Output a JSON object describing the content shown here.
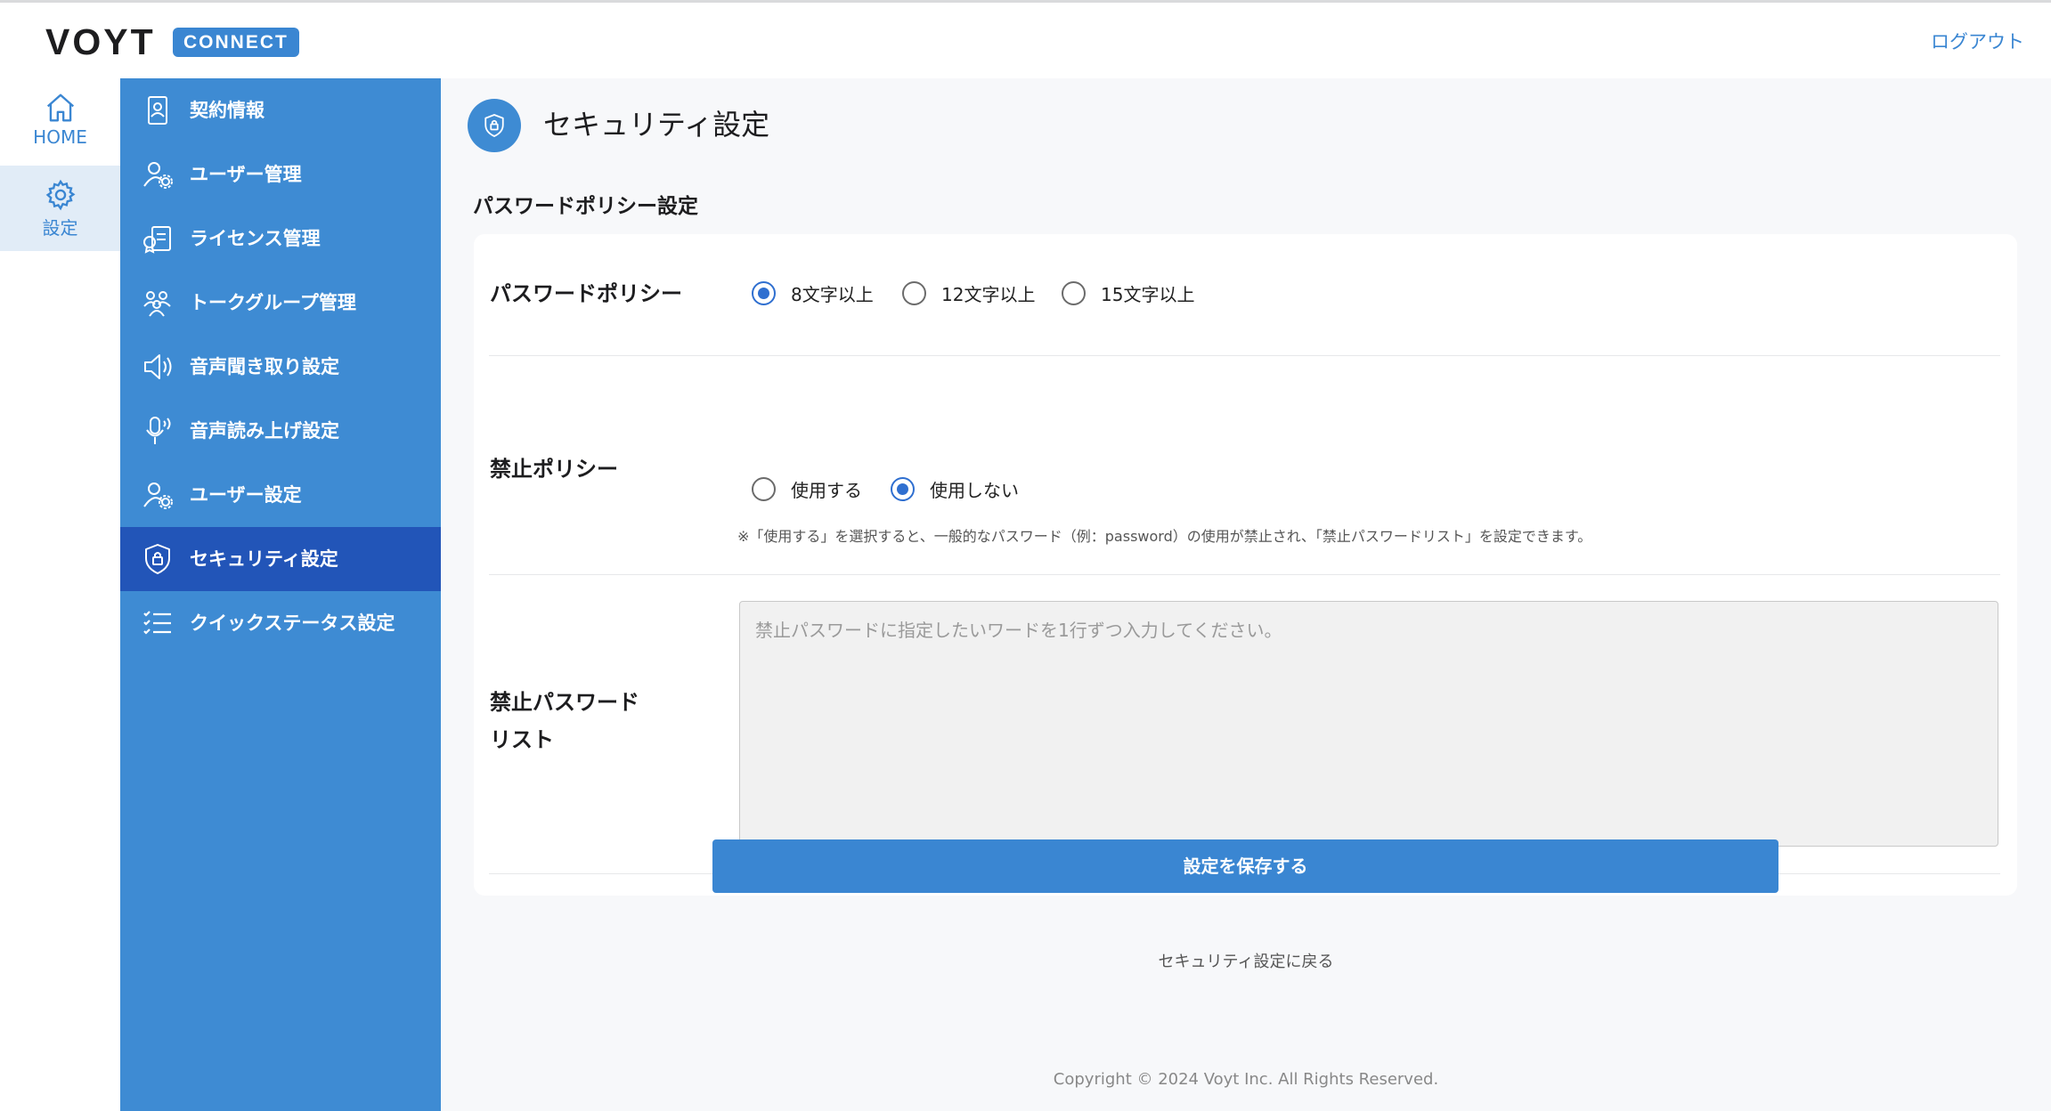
{
  "header": {
    "logo_text": "VOYT",
    "logo_badge": "CONNECT",
    "logout": "ログアウト"
  },
  "nav": {
    "home_label": "HOME",
    "settings_label": "設定"
  },
  "sidebar": {
    "items": [
      {
        "label": "契約情報",
        "icon": "contract-icon"
      },
      {
        "label": "ユーザー管理",
        "icon": "user-gear-icon"
      },
      {
        "label": "ライセンス管理",
        "icon": "license-icon"
      },
      {
        "label": "トークグループ管理",
        "icon": "group-icon"
      },
      {
        "label": "音声聞き取り設定",
        "icon": "speaker-icon"
      },
      {
        "label": "音声読み上げ設定",
        "icon": "microphone-icon"
      },
      {
        "label": "ユーザー設定",
        "icon": "user-gear-icon"
      },
      {
        "label": "セキュリティ設定",
        "icon": "shield-icon",
        "active": true
      },
      {
        "label": "クイックステータス設定",
        "icon": "checklist-icon"
      }
    ]
  },
  "page": {
    "title": "セキュリティ設定",
    "section_title": "パスワードポリシー設定",
    "password_policy": {
      "label": "パスワードポリシー",
      "options": [
        "8文字以上",
        "12文字以上",
        "15文字以上"
      ],
      "selected": "8文字以上"
    },
    "prohibit_policy": {
      "label": "禁止ポリシー",
      "options": [
        "使用する",
        "使用しない"
      ],
      "selected": "使用しない",
      "note": "※「使用する」を選択すると、一般的なパスワード（例：password）の使用が禁止され、「禁止パスワードリスト」を設定できます。"
    },
    "prohibit_list": {
      "label_line1": "禁止パスワード",
      "label_line2": "リスト",
      "placeholder": "禁止パスワードに指定したいワードを1行ずつ入力してください。"
    },
    "save_button": "設定を保存する",
    "back_link": "セキュリティ設定に戻る",
    "copyright": "Copyright © 2024 Voyt Inc. All Rights Reserved."
  },
  "colors": {
    "brand_blue": "#3a86d2",
    "sidebar_blue": "#3e8bd3",
    "sidebar_active": "#2255b8",
    "radio_checked": "#2f6fd0"
  }
}
